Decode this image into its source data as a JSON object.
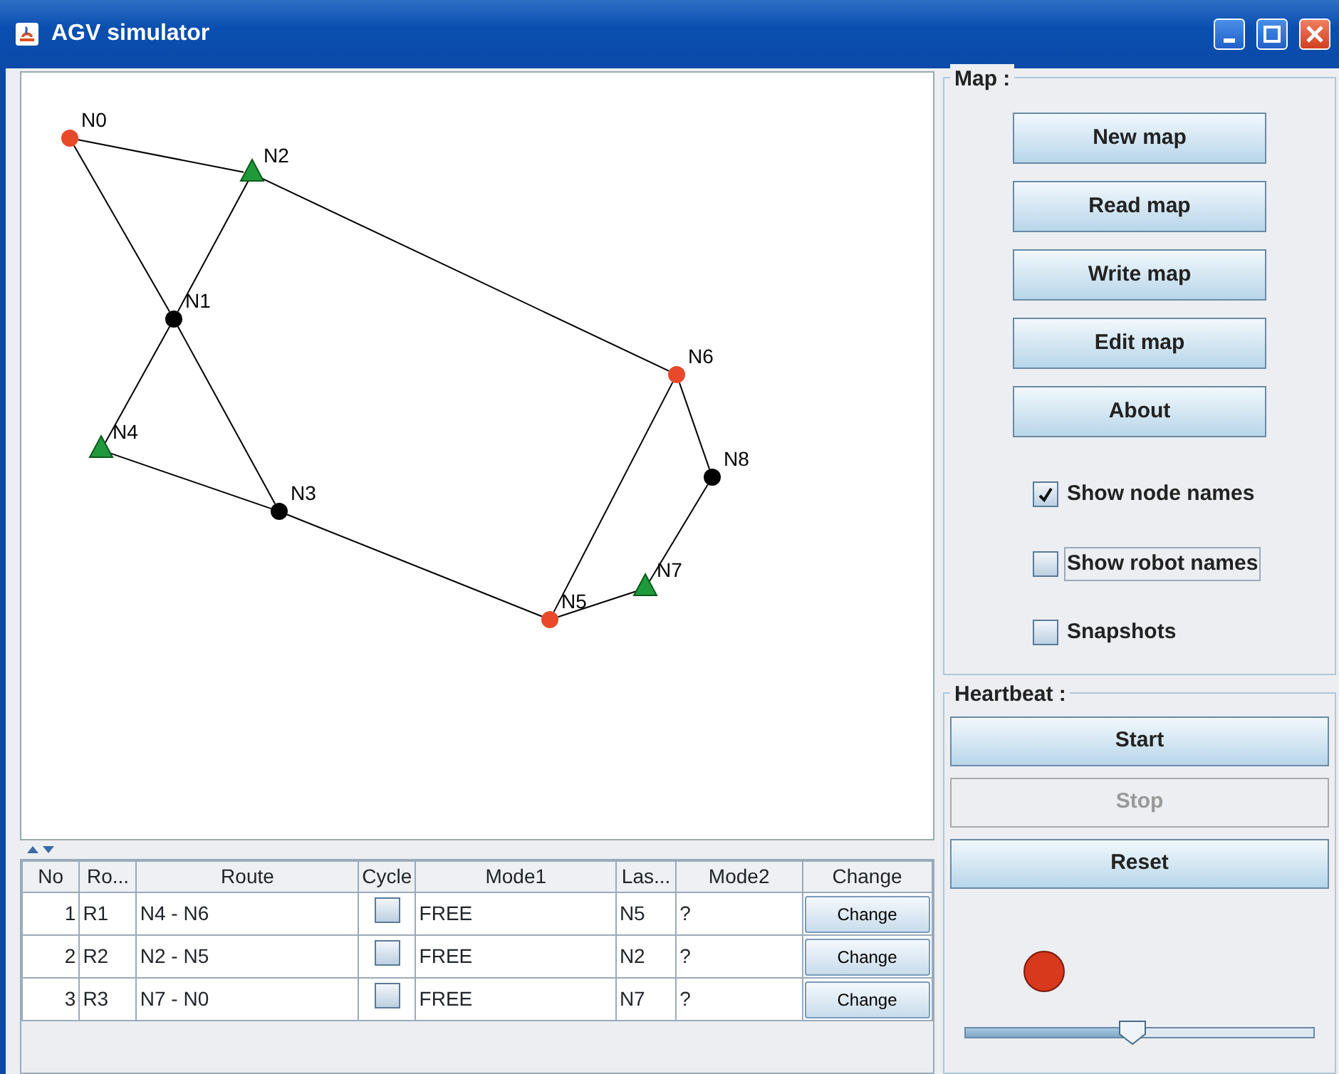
{
  "window": {
    "title": "AGV simulator"
  },
  "map": {
    "nodes": [
      {
        "label": "N0",
        "kind": "dot",
        "color": "#e8492a"
      },
      {
        "label": "N1",
        "kind": "dot",
        "color": "#000000"
      },
      {
        "label": "N2",
        "kind": "robot",
        "color": "#1e9a3a"
      },
      {
        "label": "N3",
        "kind": "dot",
        "color": "#000000"
      },
      {
        "label": "N4",
        "kind": "robot",
        "color": "#1e9a3a"
      },
      {
        "label": "N5",
        "kind": "dot",
        "color": "#e8492a"
      },
      {
        "label": "N6",
        "kind": "dot",
        "color": "#e8492a"
      },
      {
        "label": "N7",
        "kind": "robot",
        "color": "#1e9a3a"
      },
      {
        "label": "N8",
        "kind": "dot",
        "color": "#000000"
      }
    ]
  },
  "table": {
    "columns": [
      "No",
      "Ro...",
      "Route",
      "Cycle",
      "Mode1",
      "Las...",
      "Mode2",
      "Change"
    ],
    "rows": [
      {
        "no": "1",
        "robot": "R1",
        "route": "N4 - N6",
        "cycle": false,
        "mode1": "FREE",
        "last": "N5",
        "mode2": "?",
        "action": "Change"
      },
      {
        "no": "2",
        "robot": "R2",
        "route": "N2 - N5",
        "cycle": false,
        "mode1": "FREE",
        "last": "N2",
        "mode2": "?",
        "action": "Change"
      },
      {
        "no": "3",
        "robot": "R3",
        "route": "N7 - N0",
        "cycle": false,
        "mode1": "FREE",
        "last": "N7",
        "mode2": "?",
        "action": "Change"
      }
    ]
  },
  "map_panel": {
    "title": "Map :",
    "buttons": [
      "New map",
      "Read map",
      "Write map",
      "Edit map",
      "About"
    ],
    "options": [
      {
        "label": "Show node names",
        "checked": true,
        "focused": false
      },
      {
        "label": "Show robot names",
        "checked": false,
        "focused": true
      },
      {
        "label": "Snapshots",
        "checked": false,
        "focused": false
      }
    ]
  },
  "heartbeat": {
    "title": "Heartbeat :",
    "buttons": [
      {
        "label": "Start",
        "disabled": false
      },
      {
        "label": "Stop",
        "disabled": true
      },
      {
        "label": "Reset",
        "disabled": false
      }
    ],
    "slider": {
      "level": 0.48
    }
  }
}
